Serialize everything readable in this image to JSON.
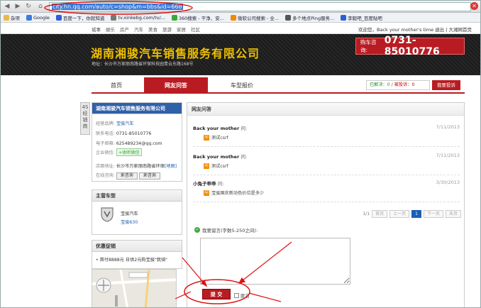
{
  "browser": {
    "url_selected": "city.hn.qq.com/auto/c=shop&m=bbs&id=668",
    "bookmarks": [
      {
        "label": "杂项",
        "color": "#e6b84a"
      },
      {
        "label": "Google",
        "color": "#3b7be0"
      },
      {
        "label": "百度一下，你就知道",
        "color": "#2c5fd8"
      },
      {
        "label": "tv.xinkebg.com/tv/...",
        "color": "#777777"
      },
      {
        "label": "360搜索 - 干净、安...",
        "color": "#3aa83a"
      },
      {
        "label": "微软公司搜索 - 全...",
        "color": "#f08a00"
      },
      {
        "label": "多个地点Ping服务...",
        "color": "#555555"
      },
      {
        "label": "李毅吧_百度贴吧",
        "color": "#2c5fd8"
      }
    ]
  },
  "topbar": {
    "nav": [
      "城事",
      "娱乐",
      "房产",
      "汽车",
      "美食",
      "旅游",
      "家居",
      "社区"
    ],
    "welcome": "欢迎您，Back your mother's time 退出 | 大湘网首页"
  },
  "header": {
    "shop_name": "湖南湘骏汽车销售服务有限公司",
    "address": "地址：长沙市万家丽南路省环保科技园青云东路168号",
    "phone_label": "购车咨询:",
    "phone": "0731-85010776"
  },
  "tabs": [
    "首页",
    "网友问答",
    "车型报价"
  ],
  "stats": {
    "solved": "已解决：0",
    "complained": "被投诉：0"
  },
  "complain_button": "我要投诉",
  "badge": "4S经销商",
  "dealer": {
    "title": "湖南湘骏汽车销售服务有限公司",
    "brand_label": "经营品牌:",
    "brand": "宝骏汽车",
    "phone_label": "联系电话:",
    "phone": "0731-85010776",
    "email_label": "电子邮箱:",
    "email": "625489234@qq.com",
    "wechat_label": "企业微信:",
    "wechat": "+收听微信",
    "store_label": "店面地址:",
    "store": "长沙市万家丽南路省环保",
    "map_link": "[地图]",
    "online_label": "在线咨询:",
    "qq_button": "来咨询"
  },
  "models": {
    "title": "主营车型",
    "brand": "宝骏汽车",
    "model": "宝骏630"
  },
  "promo": {
    "title": "优惠促销",
    "item": "• 首付8888元 日供2元购宝骏\"我骑\""
  },
  "qa": {
    "title": "网友问答",
    "asked_suffix": "问:",
    "answer_icon": "问",
    "items": [
      {
        "user": "Back your mother",
        "date": "7/11/2013",
        "text": "测试csrf"
      },
      {
        "user": "Back your mother",
        "date": "7/11/2013",
        "text": "测试csrf"
      },
      {
        "user": "小兔子乖乖",
        "date": "3/30/2013",
        "text": "宝骏国庆新动色价位是多少"
      }
    ],
    "pager": {
      "info": "1/1",
      "first": "首页",
      "prev": "上一页",
      "current": "1",
      "next": "下一页",
      "last": "末页"
    },
    "message_label": "我要留言(字数5-250之间):",
    "submit": "提 交",
    "anonymous": "匿名"
  }
}
